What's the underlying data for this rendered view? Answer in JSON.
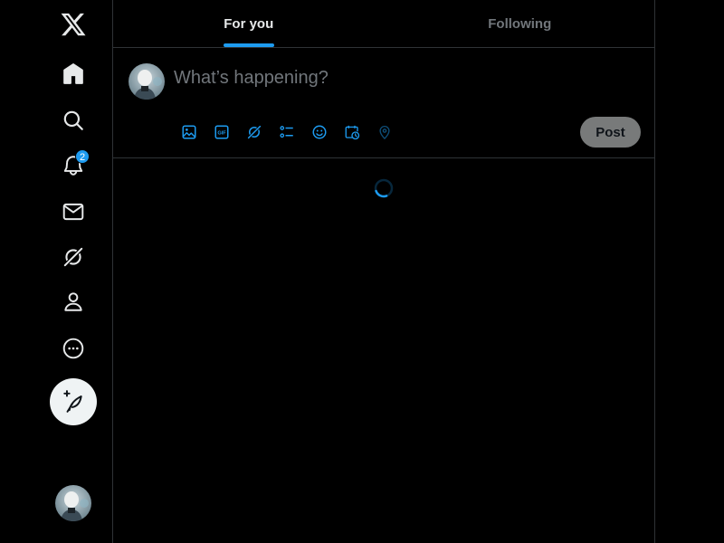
{
  "colors": {
    "background": "#000000",
    "accent": "#1d9bf0",
    "text_primary": "#e7e9ea",
    "text_secondary": "#71767b",
    "border": "#2f3336"
  },
  "sidebar": {
    "items": [
      {
        "id": "logo",
        "icon": "x-logo-icon"
      },
      {
        "id": "home",
        "icon": "home-icon"
      },
      {
        "id": "explore",
        "icon": "search-icon"
      },
      {
        "id": "notifications",
        "icon": "bell-icon",
        "badge": "2"
      },
      {
        "id": "messages",
        "icon": "envelope-icon"
      },
      {
        "id": "grok",
        "icon": "grok-icon"
      },
      {
        "id": "profile",
        "icon": "person-icon"
      },
      {
        "id": "more",
        "icon": "more-circle-icon"
      }
    ],
    "compose_icon": "feather-plus-icon",
    "avatar_icon": "avatar"
  },
  "tabs": [
    {
      "label": "For you",
      "active": true
    },
    {
      "label": "Following",
      "active": false
    }
  ],
  "composer": {
    "placeholder": "What’s happening?",
    "tools": [
      "image-icon",
      "gif-icon",
      "grok-icon",
      "poll-icon",
      "emoji-icon",
      "schedule-icon",
      "location-icon"
    ],
    "post_label": "Post"
  },
  "feed": {
    "state": "loading"
  }
}
